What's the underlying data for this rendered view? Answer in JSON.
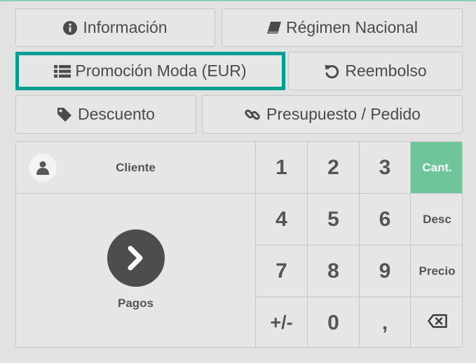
{
  "actions": {
    "info": "Información",
    "fiscal": "Régimen Nacional",
    "promo": "Promoción Moda (EUR)",
    "refund": "Reembolso",
    "discount": "Descuento",
    "quote": "Presupuesto / Pedido"
  },
  "customer": {
    "label": "Cliente"
  },
  "payment": {
    "label": "Pagos"
  },
  "numpad": {
    "k1": "1",
    "k2": "2",
    "k3": "3",
    "k4": "4",
    "k5": "5",
    "k6": "6",
    "k7": "7",
    "k8": "8",
    "k9": "9",
    "sign": "+/-",
    "k0": "0",
    "comma": ",",
    "qty": "Cant.",
    "disc": "Desc",
    "price": "Precio",
    "backspace_icon": "backspace-icon"
  },
  "colors": {
    "selected_border": "#019e92",
    "active_mode": "#6ec59a"
  }
}
